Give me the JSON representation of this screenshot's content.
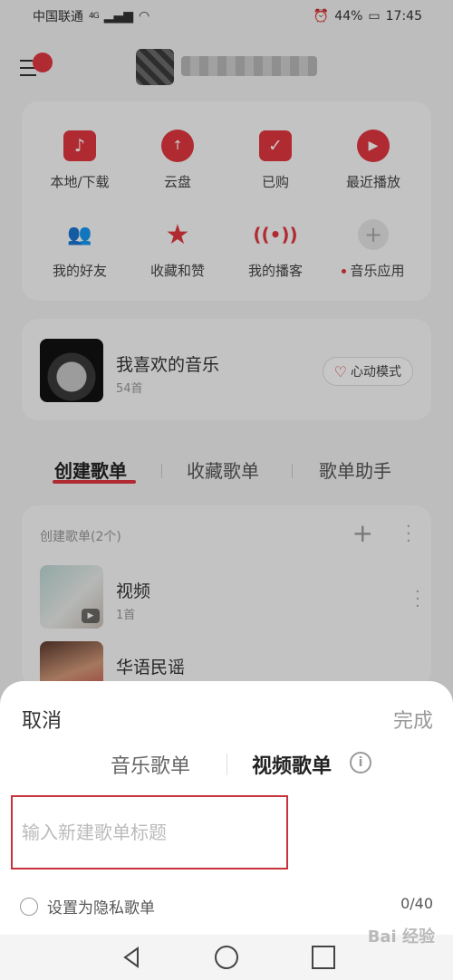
{
  "status_bar": {
    "carrier": "中国联通",
    "network": "4G",
    "battery": "44%",
    "time": "17:45"
  },
  "header": {
    "menu_icon": "menu-icon"
  },
  "entries": [
    {
      "label": "本地/下载",
      "icon": "music-note-icon"
    },
    {
      "label": "云盘",
      "icon": "cloud-upload-icon"
    },
    {
      "label": "已购",
      "icon": "shopping-bag-icon"
    },
    {
      "label": "最近播放",
      "icon": "play-circle-icon"
    },
    {
      "label": "我的好友",
      "icon": "friends-icon"
    },
    {
      "label": "收藏和赞",
      "icon": "star-icon"
    },
    {
      "label": "我的播客",
      "icon": "podcast-icon"
    },
    {
      "label": "音乐应用",
      "icon": "plus-icon"
    }
  ],
  "favorites": {
    "title": "我喜欢的音乐",
    "count": "54首",
    "mode_label": "心动模式"
  },
  "tabs": {
    "created": "创建歌单",
    "collected": "收藏歌单",
    "assistant": "歌单助手"
  },
  "playlists": {
    "header": "创建歌单(2个)",
    "items": [
      {
        "title": "视频",
        "count": "1首"
      },
      {
        "title": "华语民谣",
        "count": ""
      }
    ]
  },
  "sheet": {
    "cancel": "取消",
    "done": "完成",
    "tab_music": "音乐歌单",
    "tab_video": "视频歌单",
    "input_placeholder": "输入新建歌单标题",
    "input_value": "",
    "private_label": "设置为隐私歌单",
    "char_count": "0/40"
  },
  "watermark": "Bai 经验",
  "colors": {
    "accent": "#e2363f",
    "highlight_border": "#c8323a"
  }
}
